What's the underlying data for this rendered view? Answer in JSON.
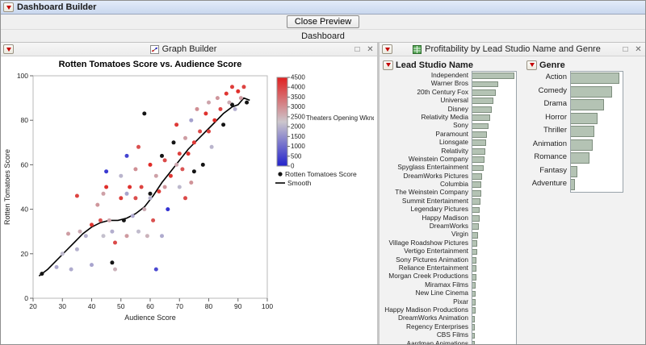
{
  "window": {
    "title": "Dashboard Builder"
  },
  "toolbar": {
    "close_preview_label": "Close Preview",
    "dashboard_label": "Dashboard"
  },
  "panels": {
    "graph_builder": {
      "title": "Graph Builder"
    },
    "profitability": {
      "title": "Profitability by Lead Studio Name and Genre"
    }
  },
  "colors": {
    "red_triangle": "#c40000",
    "bar_fill": "#b4c3b4",
    "bar_border": "#7e8e7e",
    "titlebar": "#c9d7ee",
    "point_high": "#e02020",
    "point_low": "#2222cc",
    "smooth_line": "#000000"
  },
  "chart_data": [
    {
      "type": "scatter",
      "title": "Rotten Tomatoes Score vs. Audience Score",
      "xlabel": "Audience Score",
      "ylabel": "Rotten Tomatoes Score",
      "xlim": [
        20,
        100
      ],
      "ylim": [
        0,
        100
      ],
      "xticks": [
        20,
        30,
        40,
        50,
        60,
        70,
        80,
        90,
        100
      ],
      "yticks": [
        0,
        20,
        40,
        60,
        80,
        100
      ],
      "color_legend": {
        "label": "Theaters Opening Wknd",
        "min": 0,
        "max": 4500,
        "ticks": [
          4500,
          4000,
          3500,
          3000,
          2500,
          2000,
          1500,
          1000,
          500,
          0
        ]
      },
      "legend": [
        {
          "label": "Rotten Tomatoes Score",
          "marker": "dot"
        },
        {
          "label": "Smooth",
          "marker": "line"
        }
      ],
      "points_format": [
        "audience_score",
        "rotten_tomatoes_score",
        "theaters_opening_wknd_or_null"
      ],
      "points": [
        [
          23,
          11,
          null
        ],
        [
          51,
          35,
          null
        ],
        [
          58,
          83,
          null
        ],
        [
          64,
          64,
          null
        ],
        [
          68,
          70,
          null
        ],
        [
          75,
          57,
          null
        ],
        [
          78,
          60,
          null
        ],
        [
          85,
          78,
          null
        ],
        [
          88,
          87,
          null
        ],
        [
          93,
          88,
          null
        ],
        [
          47,
          16,
          null
        ],
        [
          60,
          47,
          null
        ],
        [
          45,
          57,
          250
        ],
        [
          52,
          64,
          400
        ],
        [
          66,
          40,
          150
        ],
        [
          62,
          13,
          500
        ],
        [
          35,
          46,
          4100
        ],
        [
          40,
          33,
          4300
        ],
        [
          43,
          35,
          3900
        ],
        [
          45,
          50,
          4400
        ],
        [
          48,
          25,
          4000
        ],
        [
          50,
          45,
          4200
        ],
        [
          53,
          50,
          4350
        ],
        [
          55,
          45,
          3950
        ],
        [
          57,
          50,
          4100
        ],
        [
          60,
          60,
          4450
        ],
        [
          61,
          35,
          3900
        ],
        [
          63,
          48,
          4200
        ],
        [
          65,
          62,
          4000
        ],
        [
          67,
          55,
          4300
        ],
        [
          70,
          65,
          4150
        ],
        [
          71,
          58,
          3850
        ],
        [
          73,
          65,
          4400
        ],
        [
          75,
          70,
          4250
        ],
        [
          77,
          75,
          4000
        ],
        [
          79,
          83,
          4350
        ],
        [
          80,
          75,
          4150
        ],
        [
          82,
          80,
          4450
        ],
        [
          84,
          85,
          4050
        ],
        [
          86,
          92,
          4300
        ],
        [
          88,
          95,
          4200
        ],
        [
          90,
          93,
          4400
        ],
        [
          92,
          95,
          4100
        ],
        [
          56,
          68,
          3900
        ],
        [
          72,
          45,
          4000
        ],
        [
          69,
          78,
          4250
        ],
        [
          32,
          29,
          2800
        ],
        [
          36,
          30,
          2600
        ],
        [
          42,
          42,
          2900
        ],
        [
          46,
          35,
          2700
        ],
        [
          48,
          13,
          2500
        ],
        [
          52,
          28,
          2850
        ],
        [
          55,
          58,
          3000
        ],
        [
          58,
          40,
          2600
        ],
        [
          62,
          55,
          2750
        ],
        [
          65,
          50,
          2900
        ],
        [
          69,
          60,
          2650
        ],
        [
          72,
          72,
          2800
        ],
        [
          76,
          85,
          3000
        ],
        [
          80,
          88,
          2700
        ],
        [
          83,
          90,
          2900
        ],
        [
          87,
          88,
          2600
        ],
        [
          91,
          90,
          2850
        ],
        [
          44,
          47,
          2750
        ],
        [
          59,
          28,
          2500
        ],
        [
          74,
          52,
          2950
        ],
        [
          30,
          20,
          2100
        ],
        [
          33,
          13,
          1900
        ],
        [
          38,
          28,
          2000
        ],
        [
          40,
          15,
          1800
        ],
        [
          44,
          28,
          2200
        ],
        [
          47,
          30,
          1950
        ],
        [
          50,
          55,
          2050
        ],
        [
          54,
          37,
          1850
        ],
        [
          56,
          30,
          2150
        ],
        [
          60,
          45,
          2000
        ],
        [
          64,
          28,
          1900
        ],
        [
          70,
          50,
          2100
        ],
        [
          74,
          80,
          1750
        ],
        [
          81,
          68,
          2050
        ],
        [
          89,
          85,
          1950
        ],
        [
          52,
          47,
          1800
        ],
        [
          35,
          22,
          2000
        ],
        [
          28,
          14,
          1900
        ]
      ],
      "smooth": [
        [
          22,
          10
        ],
        [
          25,
          13
        ],
        [
          28,
          17
        ],
        [
          31,
          21
        ],
        [
          34,
          25
        ],
        [
          37,
          29
        ],
        [
          40,
          32
        ],
        [
          43,
          34
        ],
        [
          46,
          35
        ],
        [
          49,
          35
        ],
        [
          52,
          36
        ],
        [
          55,
          38
        ],
        [
          58,
          41
        ],
        [
          61,
          46
        ],
        [
          64,
          52
        ],
        [
          67,
          57
        ],
        [
          70,
          62
        ],
        [
          73,
          67
        ],
        [
          76,
          71
        ],
        [
          79,
          75
        ],
        [
          82,
          79
        ],
        [
          85,
          83
        ],
        [
          88,
          86
        ],
        [
          90,
          87
        ],
        [
          92,
          90
        ],
        [
          94,
          89
        ]
      ]
    },
    {
      "type": "bar",
      "orientation": "horizontal",
      "title": "Lead Studio Name",
      "value_scale": "relative_0_to_1",
      "categories": [
        "Independent",
        "Warner Bros",
        "20th Century Fox",
        "Universal",
        "Disney",
        "Relativity Media",
        "Sony",
        "Paramount",
        "Lionsgate",
        "Relativity",
        "Weinstein Company",
        "Spyglass Entertainment",
        "DreamWorks Pictures",
        "Columbia",
        "The Weinstein Company",
        "Summit Entertainment",
        "Legendary Pictures",
        "Happy Madison",
        "DreamWorks",
        "Virgin",
        "Village Roadshow Pictures",
        "Vertigo Entertainment",
        "Sony Pictures Animation",
        "Reliance Entertainment",
        "Morgan Creek Productions",
        "Miramax Films",
        "New Line Cinema",
        "Pixar",
        "Happy Madison Productions",
        "DreamWorks Animation",
        "Regency Enterprises",
        "CBS Films",
        "Aardman Animations"
      ],
      "values": [
        0.97,
        0.6,
        0.54,
        0.48,
        0.44,
        0.4,
        0.37,
        0.34,
        0.31,
        0.29,
        0.27,
        0.25,
        0.23,
        0.21,
        0.2,
        0.19,
        0.17,
        0.16,
        0.15,
        0.13,
        0.12,
        0.11,
        0.1,
        0.1,
        0.09,
        0.08,
        0.08,
        0.07,
        0.07,
        0.06,
        0.06,
        0.05,
        0.05
      ]
    },
    {
      "type": "bar",
      "orientation": "horizontal",
      "title": "Genre",
      "value_scale": "relative_0_to_1",
      "categories": [
        "Action",
        "Comedy",
        "Drama",
        "Horror",
        "Thriller",
        "Animation",
        "Romance",
        "Fantasy",
        "Adventure"
      ],
      "values": [
        0.93,
        0.8,
        0.64,
        0.51,
        0.45,
        0.42,
        0.36,
        0.13,
        0.08
      ]
    }
  ]
}
